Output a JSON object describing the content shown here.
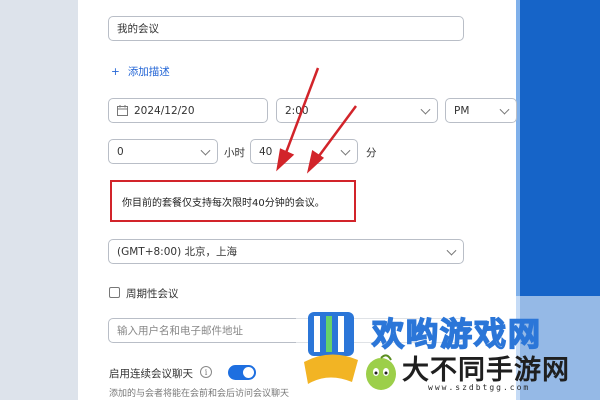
{
  "form": {
    "topic_value": "我的会议",
    "add_description": "添加描述",
    "add_icon": "+",
    "date_value": "2024/12/20",
    "time_value": "2:00",
    "ampm_value": "PM",
    "hours_value": "0",
    "hours_unit": "小时",
    "minutes_value": "40",
    "minutes_unit": "分",
    "notice_text": "你目前的套餐仅支持每次限时40分钟的会议。",
    "timezone_value": "(GMT+8:00) 北京，上海",
    "recurring_label": "周期性会议",
    "invitee_placeholder": "输入用户名和电子邮件地址",
    "continuous_chat_label": "启用连续会议聊天",
    "continuous_chat_desc": "添加的与会者将能在会前和会后访问会议聊天",
    "info_icon": "i"
  },
  "watermark": {
    "title": "欢哟游戏网",
    "subtitle": "大不同手游网",
    "url": "www.szdbtgg.com"
  },
  "colors": {
    "accent": "#1e6fe0",
    "annotation": "#d2242a",
    "right_panel": "#1664c8"
  }
}
